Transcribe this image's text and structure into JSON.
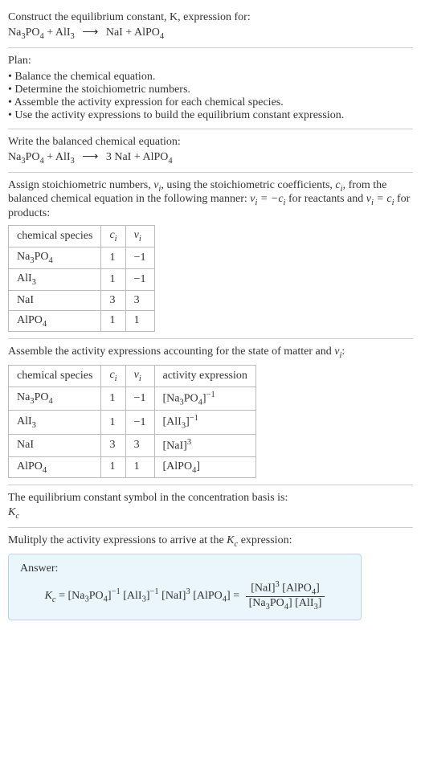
{
  "header": {
    "prompt": "Construct the equilibrium constant, K, expression for:",
    "equation_lhs_1": "Na",
    "equation_lhs_1_sub": "3",
    "equation_lhs_2": "PO",
    "equation_lhs_2_sub": "4",
    "plus1": " + AlI",
    "plus1_sub": "3",
    "arrow": "⟶",
    "rhs": " NaI + AlPO",
    "rhs_sub": "4"
  },
  "plan": {
    "title": "Plan:",
    "b1": "• Balance the chemical equation.",
    "b2": "• Determine the stoichiometric numbers.",
    "b3": "• Assemble the activity expression for each chemical species.",
    "b4": "• Use the activity expressions to build the equilibrium constant expression."
  },
  "balanced": {
    "title": "Write the balanced chemical equation:",
    "lhs1": "Na",
    "lhs1_sub": "3",
    "lhs2": "PO",
    "lhs2_sub": "4",
    "plus": " + AlI",
    "plus_sub": "3",
    "arrow": "⟶",
    "rhs": " 3 NaI + AlPO",
    "rhs_sub": "4"
  },
  "assign": {
    "text1": "Assign stoichiometric numbers, ",
    "nu": "ν",
    "sub_i": "i",
    "text2": ", using the stoichiometric coefficients, ",
    "c": "c",
    "text3": ", from the balanced chemical equation in the following manner: ",
    "eq1a": "ν",
    "eq1b": " = −",
    "eq1c": "c",
    "text4": " for reactants and ",
    "eq2a": "ν",
    "eq2b": " = ",
    "eq2c": "c",
    "text5": " for products:"
  },
  "table1": {
    "h1": "chemical species",
    "h2": "c",
    "h2_sub": "i",
    "h3": "ν",
    "h3_sub": "i",
    "r1c1a": "Na",
    "r1c1a_sub": "3",
    "r1c1b": "PO",
    "r1c1b_sub": "4",
    "r1c2": "1",
    "r1c3": "−1",
    "r2c1": "AlI",
    "r2c1_sub": "3",
    "r2c2": "1",
    "r2c3": "−1",
    "r3c1": "NaI",
    "r3c2": "3",
    "r3c3": "3",
    "r4c1": "AlPO",
    "r4c1_sub": "4",
    "r4c2": "1",
    "r4c3": "1"
  },
  "assemble": {
    "text1": "Assemble the activity expressions accounting for the state of matter and ",
    "nu": "ν",
    "sub_i": "i",
    "colon": ":"
  },
  "table2": {
    "h1": "chemical species",
    "h2": "c",
    "h2_sub": "i",
    "h3": "ν",
    "h3_sub": "i",
    "h4": "activity expression",
    "r1c1a": "Na",
    "r1c1a_sub": "3",
    "r1c1b": "PO",
    "r1c1b_sub": "4",
    "r1c2": "1",
    "r1c3": "−1",
    "r1c4a": "[Na",
    "r1c4a_sub": "3",
    "r1c4b": "PO",
    "r1c4b_sub": "4",
    "r1c4c": "]",
    "r1c4_sup": "−1",
    "r2c1": "AlI",
    "r2c1_sub": "3",
    "r2c2": "1",
    "r2c3": "−1",
    "r2c4a": "[AlI",
    "r2c4a_sub": "3",
    "r2c4b": "]",
    "r2c4_sup": "−1",
    "r3c1": "NaI",
    "r3c2": "3",
    "r3c3": "3",
    "r3c4a": "[NaI]",
    "r3c4_sup": "3",
    "r4c1": "AlPO",
    "r4c1_sub": "4",
    "r4c2": "1",
    "r4c3": "1",
    "r4c4a": "[AlPO",
    "r4c4a_sub": "4",
    "r4c4b": "]"
  },
  "eqconst": {
    "text": "The equilibrium constant symbol in the concentration basis is:",
    "K": "K",
    "Ksub": "c"
  },
  "multiply": {
    "text1": "Mulitply the activity expressions to arrive at the ",
    "K": "K",
    "Ksub": "c",
    "text2": " expression:"
  },
  "answer": {
    "label": "Answer:",
    "K": "K",
    "Ksub": "c",
    "eq": " = [Na",
    "s1": "3",
    "p2": "PO",
    "s2": "4",
    "p3": "]",
    "sup1": "−1",
    "p4": " [AlI",
    "s3": "3",
    "p5": "]",
    "sup2": "−1",
    "p6": " [NaI]",
    "sup3": "3",
    "p7": " [AlPO",
    "s4": "4",
    "p8": "] = ",
    "num1": "[NaI]",
    "num_sup": "3",
    "num2": " [AlPO",
    "num2_sub": "4",
    "num3": "]",
    "den1": "[Na",
    "den1_sub": "3",
    "den2": "PO",
    "den2_sub": "4",
    "den3": "] [AlI",
    "den3_sub": "3",
    "den4": "]"
  }
}
